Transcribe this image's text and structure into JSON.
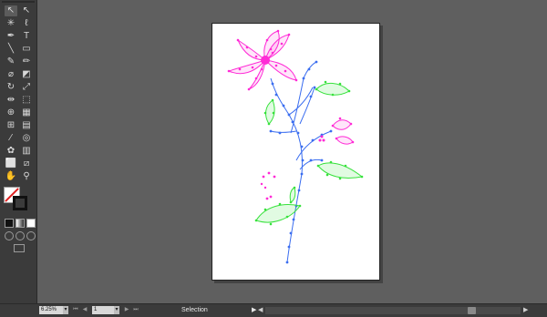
{
  "tools": [
    {
      "name": "selection-tool",
      "glyph": "↖",
      "active": true
    },
    {
      "name": "direct-selection-tool",
      "glyph": "↖"
    },
    {
      "name": "magic-wand-tool",
      "glyph": "✳"
    },
    {
      "name": "lasso-tool",
      "glyph": "ℓ"
    },
    {
      "name": "pen-tool",
      "glyph": "✒"
    },
    {
      "name": "type-tool",
      "glyph": "T"
    },
    {
      "name": "line-tool",
      "glyph": "╲"
    },
    {
      "name": "rectangle-tool",
      "glyph": "▭"
    },
    {
      "name": "paintbrush-tool",
      "glyph": "✎"
    },
    {
      "name": "pencil-tool",
      "glyph": "✏"
    },
    {
      "name": "blob-brush-tool",
      "glyph": "⌀"
    },
    {
      "name": "eraser-tool",
      "glyph": "◩"
    },
    {
      "name": "rotate-tool",
      "glyph": "↻"
    },
    {
      "name": "scale-tool",
      "glyph": "⤢"
    },
    {
      "name": "width-tool",
      "glyph": "⇹"
    },
    {
      "name": "free-transform-tool",
      "glyph": "⬚"
    },
    {
      "name": "shape-builder-tool",
      "glyph": "⊕"
    },
    {
      "name": "perspective-grid-tool",
      "glyph": "▦"
    },
    {
      "name": "mesh-tool",
      "glyph": "⊞"
    },
    {
      "name": "gradient-tool",
      "glyph": "▤"
    },
    {
      "name": "eyedropper-tool",
      "glyph": "⁄"
    },
    {
      "name": "blend-tool",
      "glyph": "◎"
    },
    {
      "name": "symbol-sprayer-tool",
      "glyph": "✿"
    },
    {
      "name": "column-graph-tool",
      "glyph": "▥"
    },
    {
      "name": "artboard-tool",
      "glyph": "⬜"
    },
    {
      "name": "slice-tool",
      "glyph": "⧄"
    },
    {
      "name": "hand-tool",
      "glyph": "✋"
    },
    {
      "name": "zoom-tool",
      "glyph": "⚲"
    }
  ],
  "status": {
    "zoom": "6.25%",
    "page": "1",
    "tool_name": "Selection"
  },
  "colors": {
    "flower": "#ff2bd6",
    "stem": "#3a6df0",
    "leaf": "#37e23c",
    "canvas": "#5f5f5f",
    "panel": "#3b3b3b"
  }
}
